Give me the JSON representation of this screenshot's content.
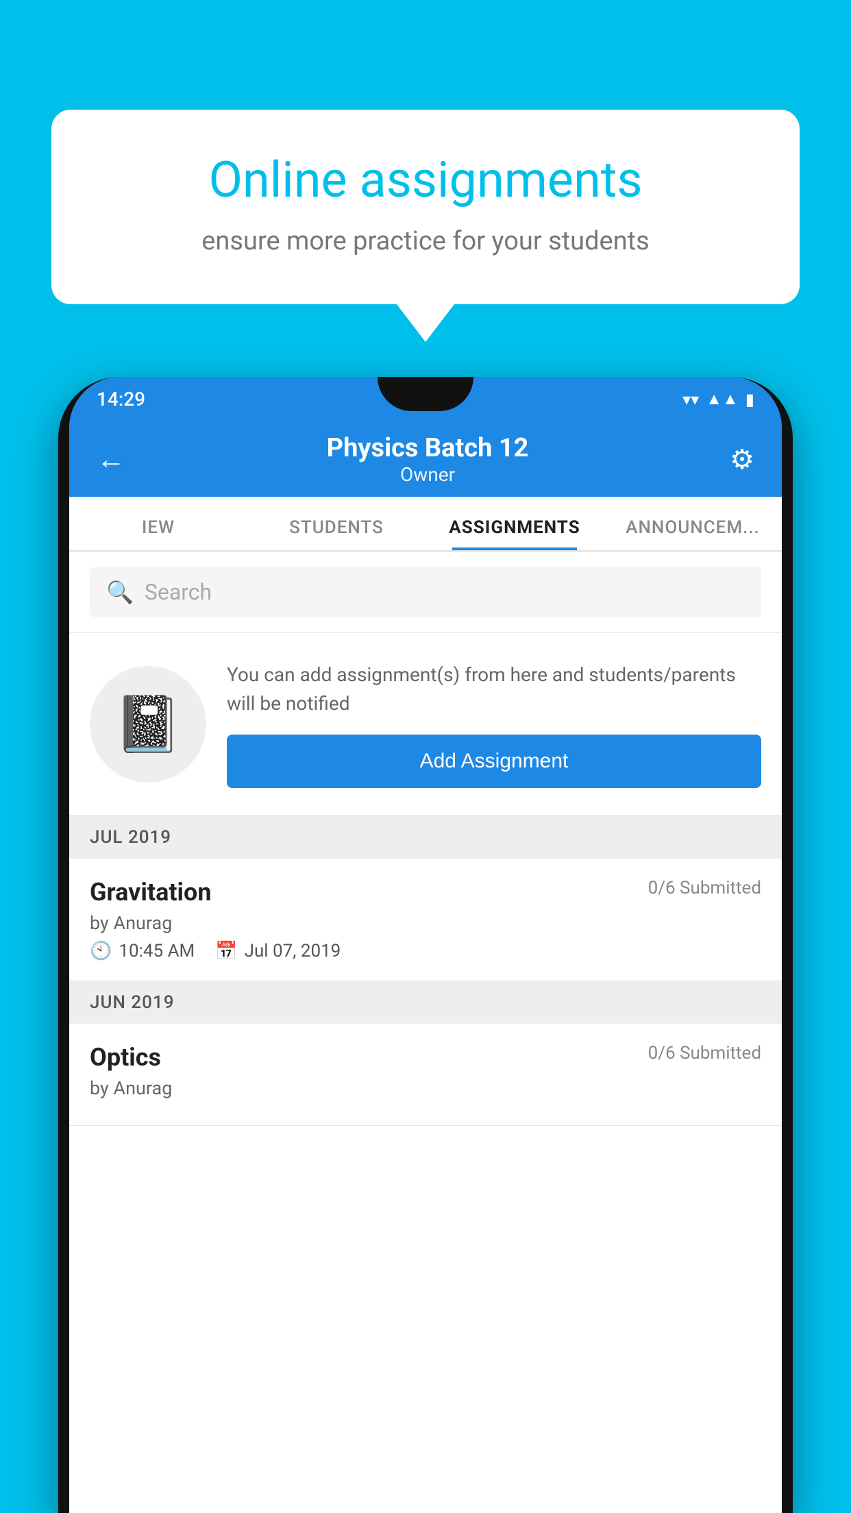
{
  "background_color": "#00BFEA",
  "speech_bubble": {
    "title": "Online assignments",
    "subtitle": "ensure more practice for your students"
  },
  "status_bar": {
    "time": "14:29",
    "icons": [
      "wifi",
      "signal",
      "battery"
    ]
  },
  "app_bar": {
    "title": "Physics Batch 12",
    "subtitle": "Owner",
    "back_label": "←",
    "settings_label": "⚙"
  },
  "tabs": [
    {
      "label": "IEW",
      "active": false
    },
    {
      "label": "STUDENTS",
      "active": false
    },
    {
      "label": "ASSIGNMENTS",
      "active": true
    },
    {
      "label": "ANNOUNCEM...",
      "active": false
    }
  ],
  "search": {
    "placeholder": "Search"
  },
  "empty_state": {
    "text": "You can add assignment(s) from here and students/parents will be notified",
    "button_label": "Add Assignment"
  },
  "sections": [
    {
      "header": "JUL 2019",
      "assignments": [
        {
          "title": "Gravitation",
          "submitted": "0/6 Submitted",
          "by": "by Anurag",
          "time": "10:45 AM",
          "date": "Jul 07, 2019"
        }
      ]
    },
    {
      "header": "JUN 2019",
      "assignments": [
        {
          "title": "Optics",
          "submitted": "0/6 Submitted",
          "by": "by Anurag",
          "time": "",
          "date": ""
        }
      ]
    }
  ]
}
